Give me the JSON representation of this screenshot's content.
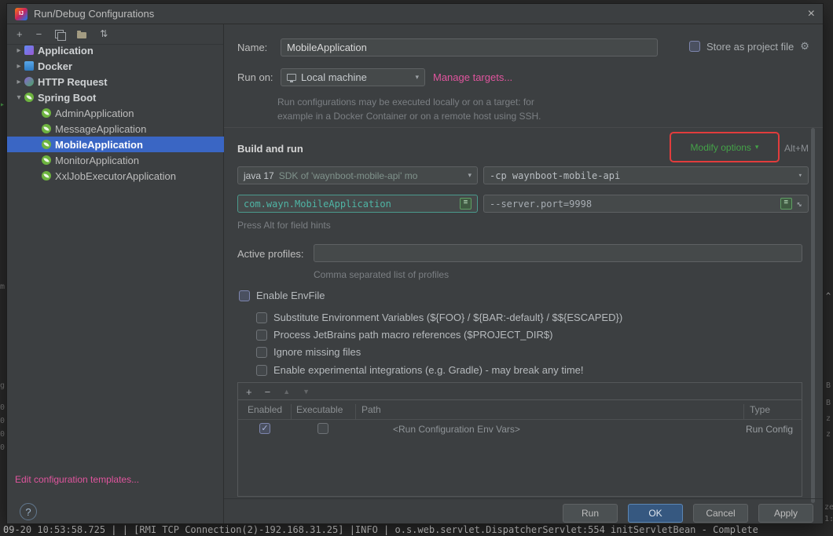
{
  "window": {
    "title": "Run/Debug Configurations"
  },
  "icons": {
    "close": "×",
    "add": "+",
    "remove": "−",
    "sort": "⇅",
    "gear": "⚙",
    "dropdown": "▾",
    "chevron_collapsed": "▸",
    "chevron_expanded": "▾",
    "check": "✓",
    "up": "▲",
    "down": "▼",
    "expand": "↔",
    "class_lines": "≡",
    "help": "?"
  },
  "colors": {
    "selection_blue": "#3a66c4",
    "link_pink": "#e0559e",
    "link_green": "#44a248",
    "annotation_red": "#e13c3c",
    "code_teal": "#4fb5a5",
    "spring_green": "#6db33f",
    "ok_button_blue": "#365880"
  },
  "sidebar": {
    "tree": {
      "application": "Application",
      "docker": "Docker",
      "http_request": "HTTP Request",
      "spring_boot": "Spring Boot",
      "children": [
        "AdminApplication",
        "MessageApplication",
        "MobileApplication",
        "MonitorApplication",
        "XxlJobExecutorApplication"
      ],
      "selected": "MobileApplication"
    },
    "edit_templates": "Edit configuration templates..."
  },
  "form": {
    "name_label": "Name:",
    "name_value": "MobileApplication",
    "store_as_project_file": "Store as project file",
    "store_checked": false,
    "run_on_label": "Run on:",
    "run_on_value": "Local machine",
    "manage_targets": "Manage targets...",
    "run_on_help_line1": "Run configurations may be executed locally or on a target: for",
    "run_on_help_line2": "example in a Docker Container or on a remote host using SSH.",
    "section_title": "Build and run",
    "modify_options": "Modify options",
    "modify_shortcut": "Alt+M",
    "jre_value": "java 17",
    "jre_detail": "SDK of 'waynboot-mobile-api' mo",
    "cp_value": "-cp waynboot-mobile-api",
    "main_class": "com.wayn.MobileApplication",
    "program_args": "--server.port=9998",
    "field_hint": "Press Alt for field hints",
    "active_profiles_label": "Active profiles:",
    "active_profiles_value": "",
    "active_profiles_hint": "Comma separated list of profiles"
  },
  "envfile": {
    "enable": "Enable EnvFile",
    "enable_checked": false,
    "opt_substitute": "Substitute Environment Variables (${FOO} / ${BAR:-default} / $${ESCAPED})",
    "opt_macros": "Process JetBrains path macro references ($PROJECT_DIR$)",
    "opt_ignore": "Ignore missing files",
    "opt_experimental": "Enable experimental integrations (e.g. Gradle) - may break any time!",
    "options_checked": [
      false,
      false,
      false,
      false
    ],
    "table": {
      "col_enabled": "Enabled",
      "col_executable": "Executable",
      "col_path": "Path",
      "col_type": "Type",
      "row_enabled": true,
      "row_executable": false,
      "row_path": "<Run Configuration Env Vars>",
      "row_type": "Run Config"
    }
  },
  "footer": {
    "run": "Run",
    "ok": "OK",
    "cancel": "Cancel",
    "apply": "Apply"
  },
  "background": {
    "log_line": "09-20 10:53:58.725 | | [RMI TCP Connection(2)-192.168.31.25] |INFO | o.s.web.servlet.DispatcherServlet:554 initServletBean - Complete",
    "left_fragments": [
      "▸",
      "m",
      "g",
      "0",
      "0",
      "0",
      "0"
    ],
    "right_fragments": [
      "^",
      "B",
      "B",
      "z",
      "z",
      "ze",
      "1:"
    ]
  }
}
